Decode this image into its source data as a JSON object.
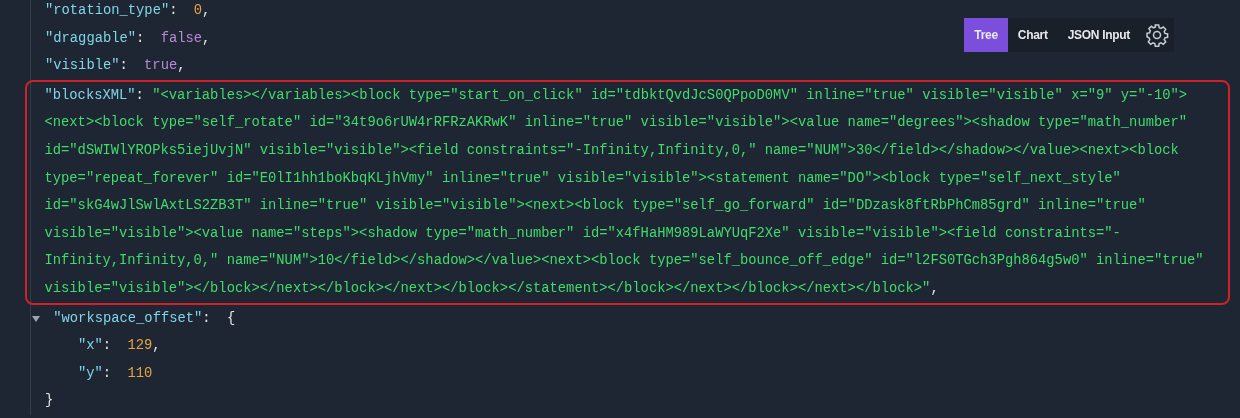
{
  "toolbar": {
    "tabs": [
      {
        "label": "Tree",
        "selected": true
      },
      {
        "label": "Chart",
        "selected": false
      },
      {
        "label": "JSON Input",
        "selected": false
      }
    ]
  },
  "tree": {
    "lines": [
      {
        "kind": "number",
        "key": "\"rotation_type\"",
        "sep": ":",
        "value": "0",
        "end": ","
      },
      {
        "kind": "boolean",
        "key": "\"draggable\"",
        "sep": ":",
        "value": "false",
        "end": ","
      },
      {
        "kind": "boolean",
        "key": "\"visible\"",
        "sep": ":",
        "value": "true",
        "end": ","
      },
      {
        "kind": "string",
        "highlighted": true,
        "key": "\"blocksXML\"",
        "sep": ":",
        "value": "\"<variables></variables><block type=\"start_on_click\" id=\"tdbktQvdJcS0QPpoD0MV\" inline=\"true\" visible=\"visible\" x=\"9\" y=\"-10\"><next><block type=\"self_rotate\" id=\"34t9o6rUW4rRFRzAKRwK\" inline=\"true\" visible=\"visible\"><value name=\"degrees\"><shadow type=\"math_number\" id=\"dSWIWlYROPks5iejUvjN\" visible=\"visible\"><field constraints=\"-Infinity,Infinity,0,\" name=\"NUM\">30</field></shadow></value><next><block type=\"repeat_forever\" id=\"E0lI1hh1boKbqKLjhVmy\" inline=\"true\" visible=\"visible\"><statement name=\"DO\"><block type=\"self_next_style\" id=\"skG4wJlSwlAxtLS2ZB3T\" inline=\"true\" visible=\"visible\"><next><block type=\"self_go_forward\" id=\"DDzask8ftRbPhCm85grd\" inline=\"true\" visible=\"visible\"><value name=\"steps\"><shadow type=\"math_number\" id=\"x4fHaHM989LaWYUqF2Xe\" visible=\"visible\"><field constraints=\"-Infinity,Infinity,0,\" name=\"NUM\">10</field></shadow></value><next><block type=\"self_bounce_off_edge\" id=\"l2FS0TGch3Pgh864g5w0\" inline=\"true\" visible=\"visible\"></block></next></block></next></block></statement></block></next></block></next></block>\"",
        "end": ","
      },
      {
        "kind": "object",
        "expanded": true,
        "key": "\"workspace_offset\"",
        "sep": ":",
        "open": "{",
        "close": "}",
        "children": [
          {
            "kind": "number",
            "key": "\"x\"",
            "sep": ":",
            "value": "129",
            "end": ","
          },
          {
            "kind": "number",
            "key": "\"y\"",
            "sep": ":",
            "value": "110"
          }
        ]
      }
    ]
  }
}
